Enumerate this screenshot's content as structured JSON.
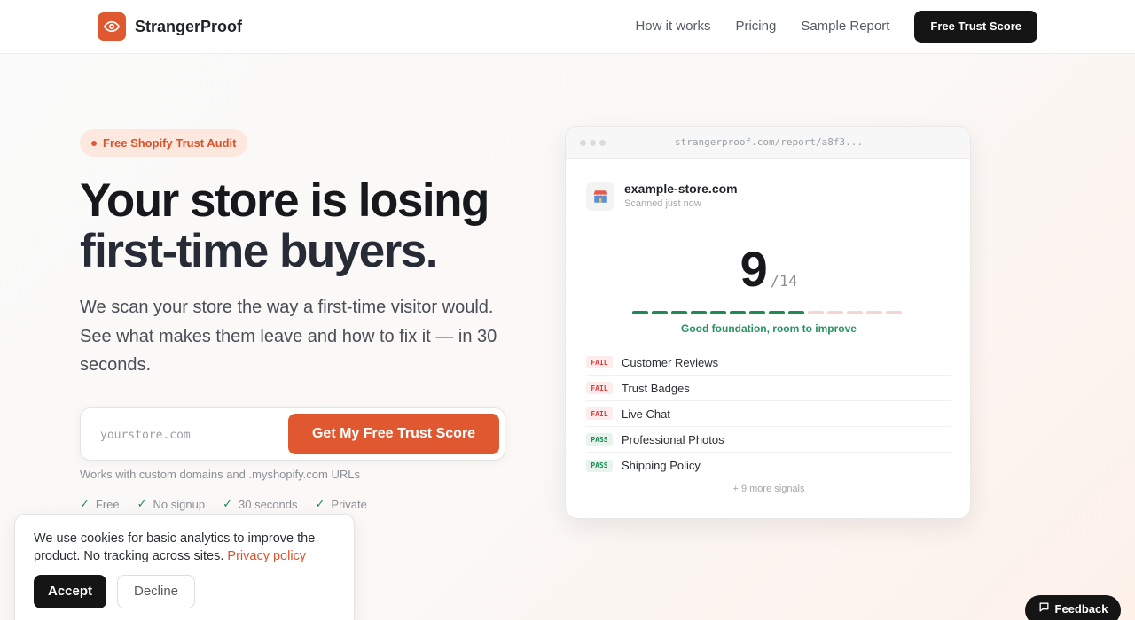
{
  "header": {
    "brand": "StrangerProof",
    "nav": [
      "How it works",
      "Pricing",
      "Sample Report"
    ],
    "cta": "Free Trust Score"
  },
  "hero": {
    "badge": "Free Shopify Trust Audit",
    "headline_line1": "Your store is losing",
    "headline_line2": "first-time buyers.",
    "subhead": "We scan your store the way a first-time visitor would. See what makes them leave and how to fix it — in 30 seconds.",
    "input_placeholder": "yourstore.com",
    "submit_label": "Get My Free Trust Score",
    "helper": "Works with custom domains and .myshopify.com URLs",
    "checks": [
      "Free",
      "No signup",
      "30 seconds",
      "Private"
    ]
  },
  "report": {
    "url": "strangerproof.com/report/a8f3...",
    "store_name": "example-store.com",
    "scanned": "Scanned just now",
    "score": "9",
    "total": "/14",
    "score_value": 9,
    "score_max": 14,
    "verdict": "Good foundation, room to improve",
    "signals": [
      {
        "status": "FAIL",
        "name": "Customer Reviews"
      },
      {
        "status": "FAIL",
        "name": "Trust Badges"
      },
      {
        "status": "FAIL",
        "name": "Live Chat"
      },
      {
        "status": "PASS",
        "name": "Professional Photos"
      },
      {
        "status": "PASS",
        "name": "Shipping Policy"
      }
    ],
    "more": "+ 9 more signals"
  },
  "cookie": {
    "text": "We use cookies for basic analytics to improve the product. No tracking across sites.",
    "link": "Privacy policy",
    "accept": "Accept",
    "decline": "Decline"
  },
  "feedback": "Feedback",
  "colors": {
    "accent": "#e0582f",
    "pass": "#1f8a58",
    "fail": "#d14343",
    "dark": "#151515"
  }
}
